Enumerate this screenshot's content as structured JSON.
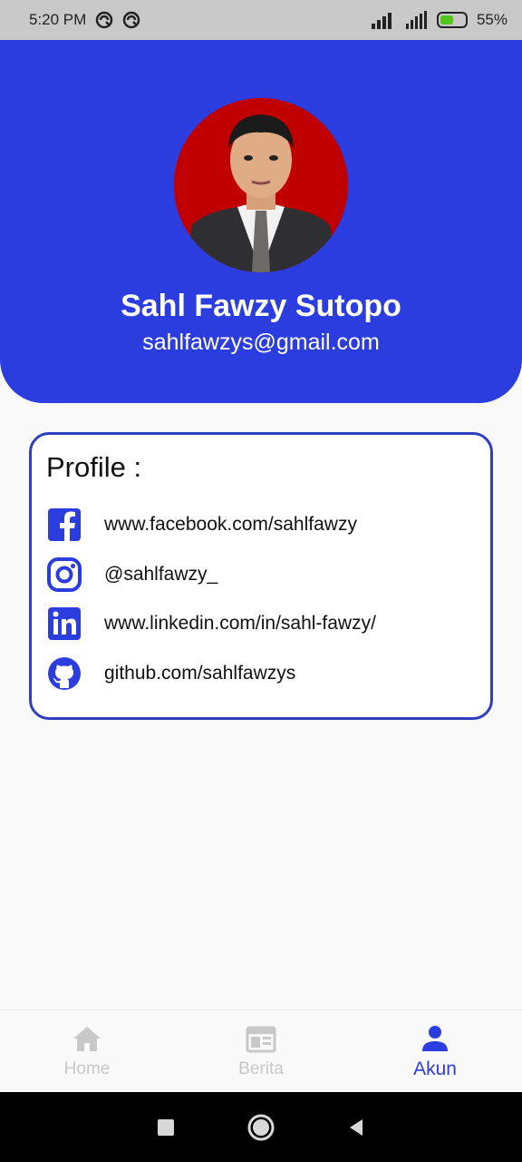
{
  "status_bar": {
    "time": "5:20 PM",
    "battery_percent": "55%",
    "battery_level": 0.55
  },
  "profile": {
    "name": "Sahl Fawzy Sutopo",
    "email": "sahlfawzys@gmail.com"
  },
  "card": {
    "title": "Profile :",
    "links": [
      {
        "icon": "facebook-icon",
        "text": "www.facebook.com/sahlfawzy"
      },
      {
        "icon": "instagram-icon",
        "text": "@sahlfawzy_"
      },
      {
        "icon": "linkedin-icon",
        "text": "www.linkedin.com/in/sahl-fawzy/"
      },
      {
        "icon": "github-icon",
        "text": "github.com/sahlfawzys"
      }
    ]
  },
  "bottom_nav": {
    "items": [
      {
        "label": "Home",
        "icon": "home-icon",
        "active": false
      },
      {
        "label": "Berita",
        "icon": "newspaper-icon",
        "active": false
      },
      {
        "label": "Akun",
        "icon": "person-icon",
        "active": true
      }
    ]
  },
  "colors": {
    "primary": "#2c3de0",
    "card_border": "#2f3fbf",
    "inactive": "#c8c8c8"
  }
}
